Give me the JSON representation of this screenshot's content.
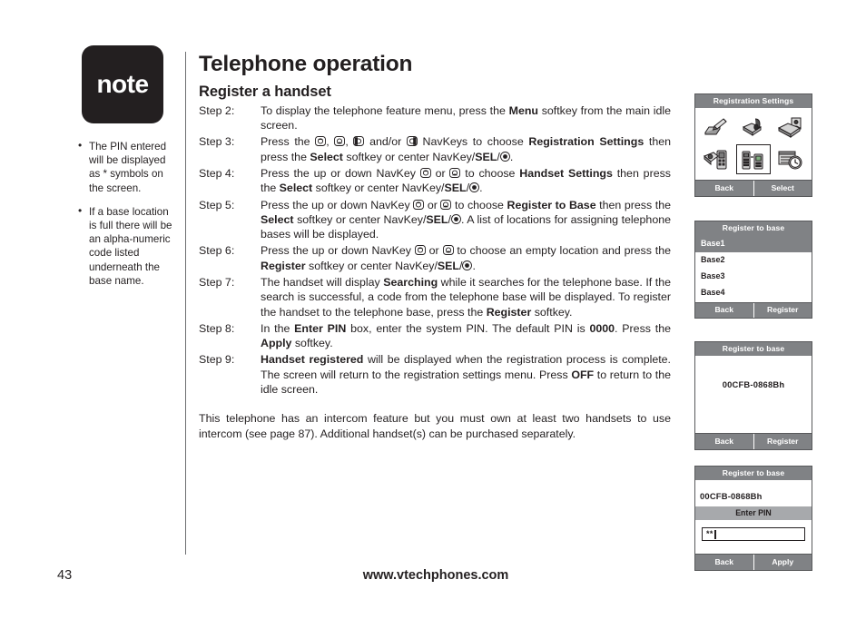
{
  "note": {
    "badge_label": "note",
    "items": [
      "The PIN entered will be displayed as * symbols on the screen.",
      "If a base location is full there will be an alpha-numeric code listed underneath the base name."
    ]
  },
  "main": {
    "page_title": "Telephone operation",
    "section_title": "Register a handset",
    "steps": [
      {
        "label": "Step 2:",
        "parts": [
          {
            "t": "To display the telephone feature menu, press the "
          },
          {
            "t": "Menu",
            "b": true
          },
          {
            "t": " softkey from the main idle screen."
          }
        ]
      },
      {
        "label": "Step 3:",
        "parts": [
          {
            "t": "Press the "
          },
          {
            "icon": "navkey-up-icon"
          },
          {
            "t": ", "
          },
          {
            "icon": "navkey-down-icon"
          },
          {
            "t": ", "
          },
          {
            "icon": "navkey-left-icon"
          },
          {
            "t": " and/or "
          },
          {
            "icon": "navkey-right-icon"
          },
          {
            "t": " NavKeys to choose "
          },
          {
            "t": "Registration Settings",
            "b": true
          },
          {
            "t": " then press the "
          },
          {
            "t": "Select",
            "b": true
          },
          {
            "t": " softkey or center NavKey/"
          },
          {
            "t": "SEL",
            "b": true
          },
          {
            "t": "/"
          },
          {
            "icon": "navkey-center-icon"
          },
          {
            "t": "."
          }
        ]
      },
      {
        "label": "Step 4:",
        "parts": [
          {
            "t": "Press the up or down NavKey "
          },
          {
            "icon": "navkey-up-icon"
          },
          {
            "t": " or "
          },
          {
            "icon": "navkey-down-icon"
          },
          {
            "t": " to choose "
          },
          {
            "t": "Handset Settings",
            "b": true
          },
          {
            "t": " then press the "
          },
          {
            "t": "Select",
            "b": true
          },
          {
            "t": " softkey or center NavKey/"
          },
          {
            "t": "SEL",
            "b": true
          },
          {
            "t": "/"
          },
          {
            "icon": "navkey-center-icon"
          },
          {
            "t": "."
          }
        ]
      },
      {
        "label": "Step 5:",
        "parts": [
          {
            "t": "Press the up or down NavKey "
          },
          {
            "icon": "navkey-up-icon"
          },
          {
            "t": " or "
          },
          {
            "icon": "navkey-down-icon"
          },
          {
            "t": " to choose "
          },
          {
            "t": "Register to Base",
            "b": true
          },
          {
            "t": " then press the "
          },
          {
            "t": "Select",
            "b": true
          },
          {
            "t": " softkey or center NavKey/"
          },
          {
            "t": "SEL",
            "b": true
          },
          {
            "t": "/"
          },
          {
            "icon": "navkey-center-icon"
          },
          {
            "t": ". A list of locations for assigning telephone bases will be displayed."
          }
        ]
      },
      {
        "label": "Step 6:",
        "parts": [
          {
            "t": "Press the up or down NavKey "
          },
          {
            "icon": "navkey-up-icon"
          },
          {
            "t": " or "
          },
          {
            "icon": "navkey-down-icon"
          },
          {
            "t": " to choose an empty location and press the "
          },
          {
            "t": "Register",
            "b": true
          },
          {
            "t": " softkey or center NavKey/"
          },
          {
            "t": "SEL",
            "b": true
          },
          {
            "t": "/"
          },
          {
            "icon": "navkey-center-icon"
          },
          {
            "t": "."
          }
        ]
      },
      {
        "label": "Step 7:",
        "parts": [
          {
            "t": "The handset will display "
          },
          {
            "t": "Searching",
            "b": true
          },
          {
            "t": " while it searches for the telephone base. If the search is successful, a code from the telephone base will be displayed. To register the handset to the telephone base, press the "
          },
          {
            "t": "Register",
            "b": true
          },
          {
            "t": " softkey."
          }
        ]
      },
      {
        "label": "Step 8:",
        "parts": [
          {
            "t": "In the "
          },
          {
            "t": "Enter PIN",
            "b": true
          },
          {
            "t": " box, enter the system PIN. The default PIN is "
          },
          {
            "t": "0000",
            "b": true
          },
          {
            "t": ". Press the "
          },
          {
            "t": "Apply",
            "b": true
          },
          {
            "t": " softkey."
          }
        ]
      },
      {
        "label": "Step 9:",
        "parts": [
          {
            "t": "Handset registered",
            "b": true
          },
          {
            "t": " will be displayed when the registration process is complete. The screen will return to the registration settings menu. Press "
          },
          {
            "t": "OFF",
            "b": true
          },
          {
            "t": " to return to the idle screen."
          }
        ]
      }
    ],
    "closing_paragraph": "This telephone has an intercom feature but you must own at least two handsets to use intercom (see page 87). Additional handset(s) can be purchased separately."
  },
  "screens": {
    "registration_settings": {
      "title": "Registration Settings",
      "icons": [
        {
          "name": "register-handset-icon",
          "selected": false
        },
        {
          "name": "deregister-handset-icon",
          "selected": false
        },
        {
          "name": "handset-directory-icon",
          "selected": false
        },
        {
          "name": "handset-settings-icon",
          "selected": false
        },
        {
          "name": "register-to-base-icon",
          "selected": true
        },
        {
          "name": "base-schedule-icon",
          "selected": false
        }
      ],
      "softkeys": [
        "Back",
        "Select"
      ]
    },
    "register_to_base_list": {
      "title": "Register to base",
      "bases": [
        {
          "label": "Base1",
          "selected": true
        },
        {
          "label": "Base2",
          "selected": false
        },
        {
          "label": "Base3",
          "selected": false
        },
        {
          "label": "Base4",
          "selected": false
        }
      ],
      "softkeys": [
        "Back",
        "Register"
      ]
    },
    "register_to_base_code": {
      "title": "Register to base",
      "code": "00CFB-0868Bh",
      "softkeys": [
        "Back",
        "Register"
      ]
    },
    "enter_pin": {
      "title": "Register to base",
      "code": "00CFB-0868Bh",
      "field_label": "Enter PIN",
      "pin_value": "**",
      "softkeys": [
        "Back",
        "Apply"
      ]
    }
  },
  "footer": {
    "page_number": "43",
    "website": "www.vtechphones.com"
  },
  "colors": {
    "ink": "#231f20",
    "screen_header_gray": "#808285",
    "field_label_gray": "#a7a9ac",
    "screen_border": "#58595b"
  }
}
